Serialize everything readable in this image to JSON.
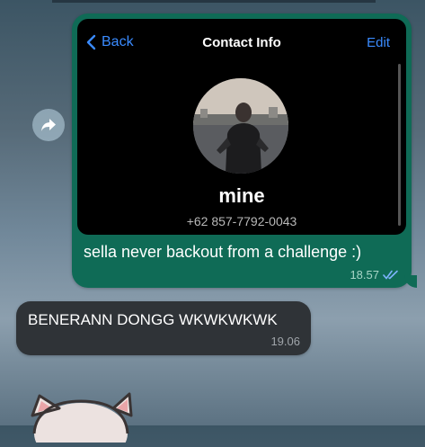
{
  "outgoing_message": {
    "screenshot": {
      "back_label": "Back",
      "title": "Contact Info",
      "edit_label": "Edit",
      "contact_name": "mine",
      "contact_phone": "+62 857-7792-0043"
    },
    "text": "sella never backout from a challenge :)",
    "time": "18.57",
    "status_icon": "double-check-icon"
  },
  "incoming_message": {
    "text": "BENERANN DONGG WKWKWKWK",
    "time": "19.06"
  },
  "forward_icon": "forward-arrow-icon",
  "colors": {
    "outgoing_bubble": "#0f6b56",
    "incoming_bubble": "#2f3337",
    "ios_link_blue": "#3a8bff",
    "read_check": "#7fb4ff"
  }
}
